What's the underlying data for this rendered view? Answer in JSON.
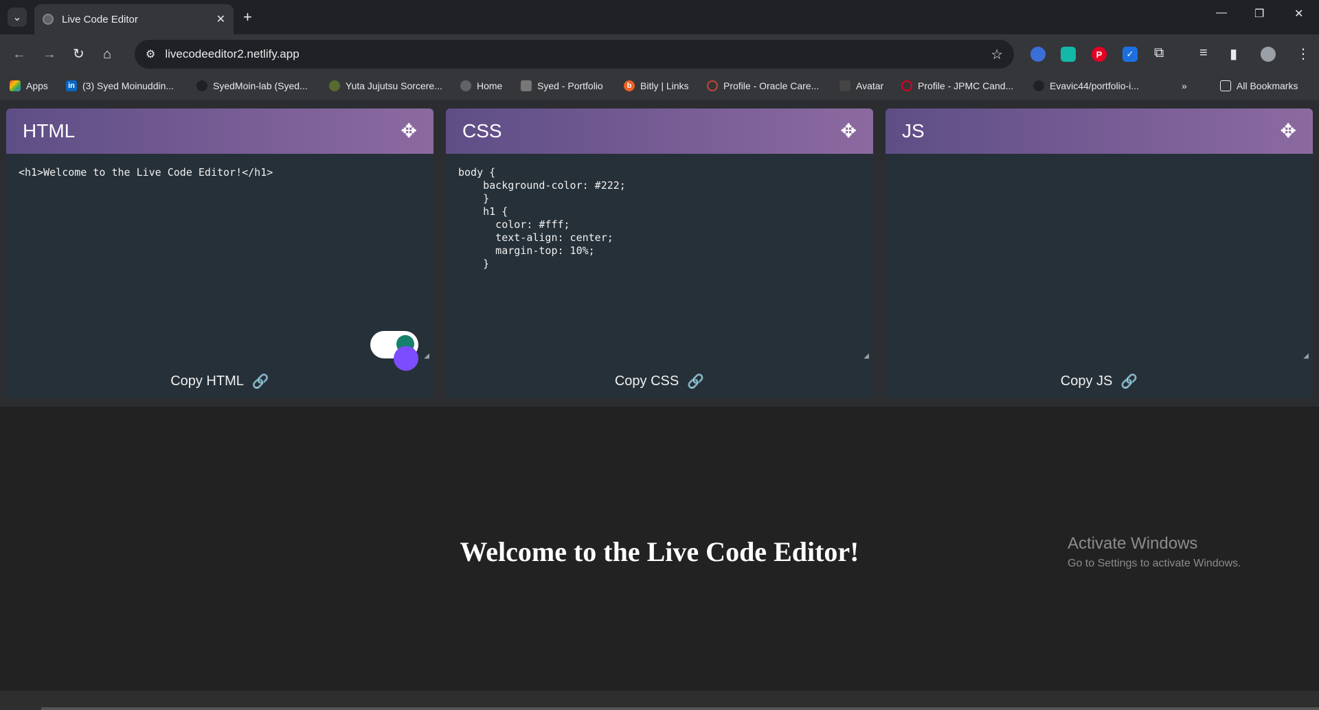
{
  "browser": {
    "tab_title": "Live Code Editor",
    "url": "livecodeeditor2.netlify.app",
    "bookmarks": [
      {
        "label": "Apps",
        "icon": "apps-grid-icon"
      },
      {
        "label": "(3) Syed Moinuddin...",
        "icon": "linkedin-icon"
      },
      {
        "label": "SyedMoin-lab (Syed...",
        "icon": "github-icon"
      },
      {
        "label": "Yuta Jujutsu Sorcere...",
        "icon": "character-icon"
      },
      {
        "label": "Home",
        "icon": "globe-icon"
      },
      {
        "label": "Syed - Portfolio",
        "icon": "portfolio-icon"
      },
      {
        "label": "Bitly | Links",
        "icon": "bitly-icon"
      },
      {
        "label": "Profile - Oracle Care...",
        "icon": "oracle-icon"
      },
      {
        "label": "Avatar",
        "icon": "avatar-icon"
      },
      {
        "label": "Profile - JPMC Cand...",
        "icon": "oracle-icon"
      },
      {
        "label": "Evavic44/portfolio-i...",
        "icon": "github-icon"
      }
    ],
    "all_bookmarks_label": "All Bookmarks"
  },
  "editor": {
    "panels": [
      {
        "title": "HTML",
        "code": "<h1>Welcome to the Live Code Editor!</h1>",
        "copy_label": "Copy HTML"
      },
      {
        "title": "CSS",
        "code": "body {\n    background-color: #222;\n    }\n    h1 {\n      color: #fff;\n      text-align: center;\n      margin-top: 10%;\n    }",
        "copy_label": "Copy CSS"
      },
      {
        "title": "JS",
        "code": "",
        "copy_label": "Copy JS"
      }
    ],
    "header_gradient": [
      "#5e4e86",
      "#8c6aa0"
    ]
  },
  "preview": {
    "heading": "Welcome to the Live Code Editor!"
  },
  "watermark": {
    "line1": "Activate Windows",
    "line2": "Go to Settings to activate Windows."
  }
}
